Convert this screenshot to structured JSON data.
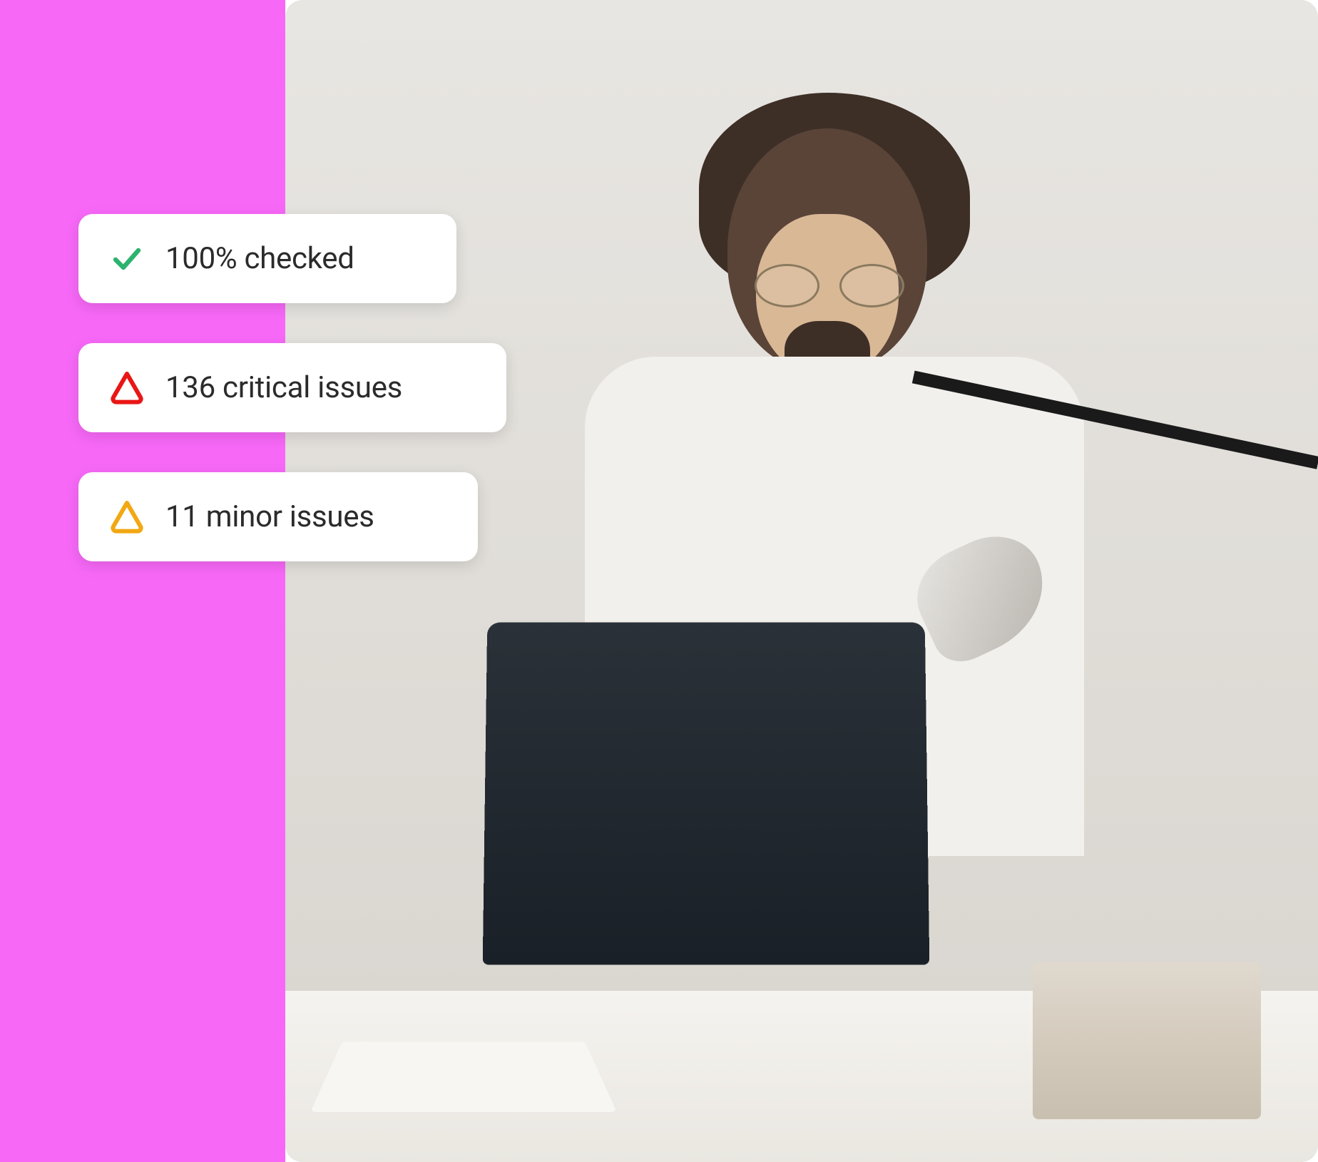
{
  "colors": {
    "accent_pink": "#f768f7",
    "check_green": "#2db36f",
    "critical_red": "#e91616",
    "minor_amber": "#f2a813"
  },
  "badges": [
    {
      "icon": "check-icon",
      "label": "100% checked",
      "type": "checked"
    },
    {
      "icon": "triangle-alert-icon",
      "label": "136 critical issues",
      "type": "critical"
    },
    {
      "icon": "triangle-alert-icon",
      "label": "11 minor issues",
      "type": "minor"
    }
  ],
  "scene": {
    "description": "Person with glasses working on laptop at desk with lamp and books"
  }
}
